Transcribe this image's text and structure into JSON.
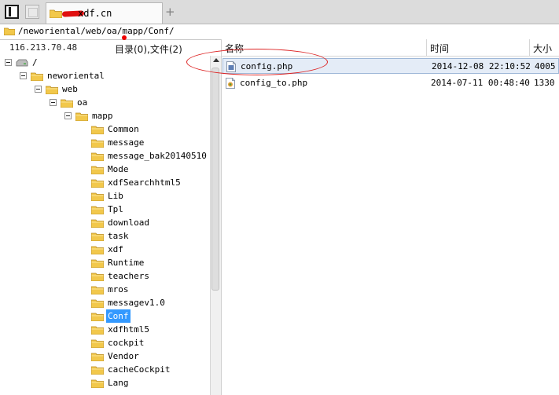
{
  "tab": {
    "label": "xdf.cn"
  },
  "address": {
    "path": "/neworiental/web/oa/mapp/Conf/"
  },
  "info": {
    "host": "116.213.70.48",
    "counts": "目录(0),文件(2)"
  },
  "columns": {
    "name": "名称",
    "time": "时间",
    "size": "大小"
  },
  "tree": [
    {
      "label": "/",
      "depth": 0,
      "kind": "drive"
    },
    {
      "label": "neworiental",
      "depth": 1,
      "kind": "folder"
    },
    {
      "label": "web",
      "depth": 2,
      "kind": "folder"
    },
    {
      "label": "oa",
      "depth": 3,
      "kind": "folder"
    },
    {
      "label": "mapp",
      "depth": 4,
      "kind": "folder"
    },
    {
      "label": "Common",
      "depth": 5,
      "kind": "leaf"
    },
    {
      "label": "message",
      "depth": 5,
      "kind": "leaf"
    },
    {
      "label": "message_bak20140510",
      "depth": 5,
      "kind": "leaf"
    },
    {
      "label": "Mode",
      "depth": 5,
      "kind": "leaf"
    },
    {
      "label": "xdfSearchhtml5",
      "depth": 5,
      "kind": "leaf"
    },
    {
      "label": "Lib",
      "depth": 5,
      "kind": "leaf"
    },
    {
      "label": "Tpl",
      "depth": 5,
      "kind": "leaf"
    },
    {
      "label": "download",
      "depth": 5,
      "kind": "leaf"
    },
    {
      "label": "task",
      "depth": 5,
      "kind": "leaf"
    },
    {
      "label": "xdf",
      "depth": 5,
      "kind": "leaf"
    },
    {
      "label": "Runtime",
      "depth": 5,
      "kind": "leaf"
    },
    {
      "label": "teachers",
      "depth": 5,
      "kind": "leaf"
    },
    {
      "label": "mros",
      "depth": 5,
      "kind": "leaf"
    },
    {
      "label": "messagev1.0",
      "depth": 5,
      "kind": "leaf"
    },
    {
      "label": "Conf",
      "depth": 5,
      "kind": "leaf",
      "selected": true
    },
    {
      "label": "xdfhtml5",
      "depth": 5,
      "kind": "leaf"
    },
    {
      "label": "cockpit",
      "depth": 5,
      "kind": "leaf"
    },
    {
      "label": "Vendor",
      "depth": 5,
      "kind": "leaf"
    },
    {
      "label": "cacheCockpit",
      "depth": 5,
      "kind": "leaf"
    },
    {
      "label": "Lang",
      "depth": 5,
      "kind": "leaf"
    }
  ],
  "files": [
    {
      "name": "config.php",
      "time": "2014-12-08 22:10:52",
      "size": "4005",
      "selected": true
    },
    {
      "name": "config_to.php",
      "time": "2014-07-11 00:48:40",
      "size": "1330",
      "selected": false
    }
  ]
}
